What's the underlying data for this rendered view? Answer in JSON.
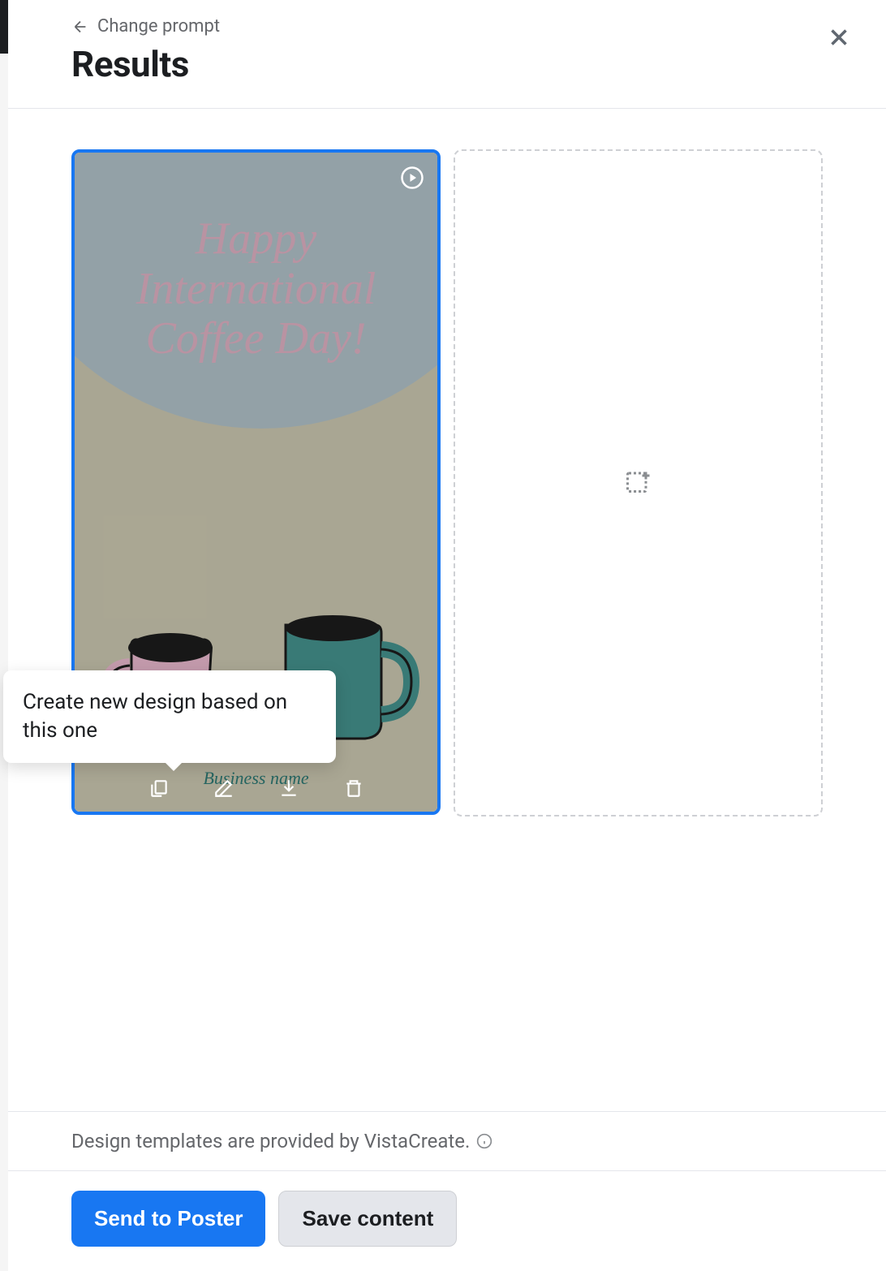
{
  "header": {
    "back_label": "Change prompt",
    "title": "Results"
  },
  "tooltip": {
    "text": "Create new design based on this one"
  },
  "design": {
    "headline_line1": "Happy",
    "headline_line2": "International",
    "headline_line3": "Coffee Day!",
    "business_name": "Business name"
  },
  "footer": {
    "info_text": "Design templates are provided by VistaCreate.",
    "primary_button": "Send to Poster",
    "secondary_button": "Save content"
  },
  "colors": {
    "accent": "#1877f2",
    "mug_pink": "#d4a8bb",
    "mug_teal": "#3e8581"
  }
}
